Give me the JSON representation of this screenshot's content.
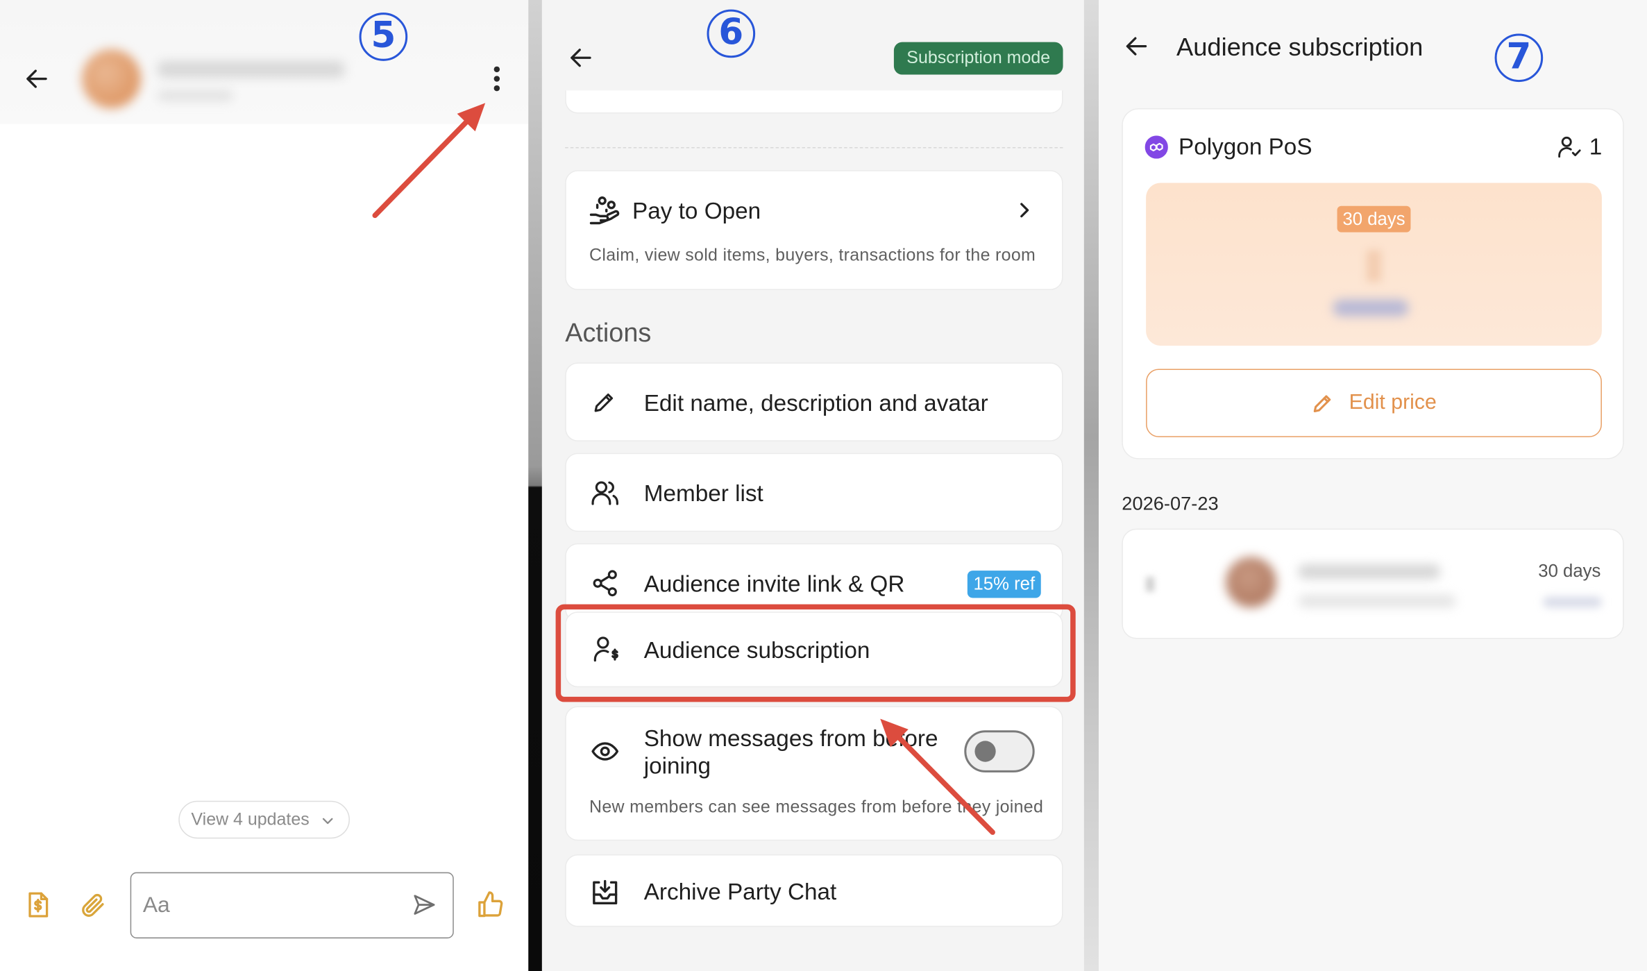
{
  "chat": {
    "step_number": "5",
    "view_updates_label": "View 4 updates",
    "composer_placeholder": "Aa"
  },
  "settings": {
    "step_number": "6",
    "mode_badge": "Subscription mode",
    "pay_to_open": {
      "title": "Pay to Open",
      "subtitle": "Claim, view sold items, buyers, transactions for the room"
    },
    "actions_heading": "Actions",
    "actions": {
      "edit": "Edit name, description and avatar",
      "members": "Member list",
      "invite": "Audience invite link & QR",
      "invite_badge": "15% ref",
      "subscription": "Audience subscription",
      "show_history": "Show messages from before joining",
      "show_history_description": "New members can see messages from before they joined",
      "show_history_enabled": false,
      "archive": "Archive Party Chat"
    }
  },
  "subscription": {
    "step_number": "7",
    "title": "Audience subscription",
    "plan": {
      "network": "Polygon PoS",
      "subscriber_count": "1",
      "duration": "30 days",
      "edit_price_label": "Edit price"
    },
    "history": {
      "date": "2026-07-23",
      "entries": [
        {
          "duration": "30 days"
        }
      ]
    }
  },
  "icons": {
    "back": "arrow-left-icon",
    "menu": "more-vertical-icon",
    "invoice": "document-dollar-icon",
    "attach": "paperclip-icon",
    "send": "send-icon",
    "like": "thumbs-up-icon",
    "pay_to_open": "hand-coins-icon",
    "chevron": "chevron-right-icon",
    "edit": "pencil-icon",
    "members": "users-icon",
    "share": "share-icon",
    "subscription": "user-dollar-icon",
    "history": "eye-icon",
    "archive": "archive-icon",
    "network": "polygon-logo-icon",
    "subscribers": "user-check-icon"
  },
  "colors": {
    "annotation_red": "#dc4c3e",
    "step_blue": "#2856d9",
    "badge_green": "#2f7a4f",
    "badge_blue": "#3ea6e8",
    "accent_orange": "#e2914c",
    "composer_gold": "#dca23a",
    "brand_purple": "#8247e5"
  }
}
